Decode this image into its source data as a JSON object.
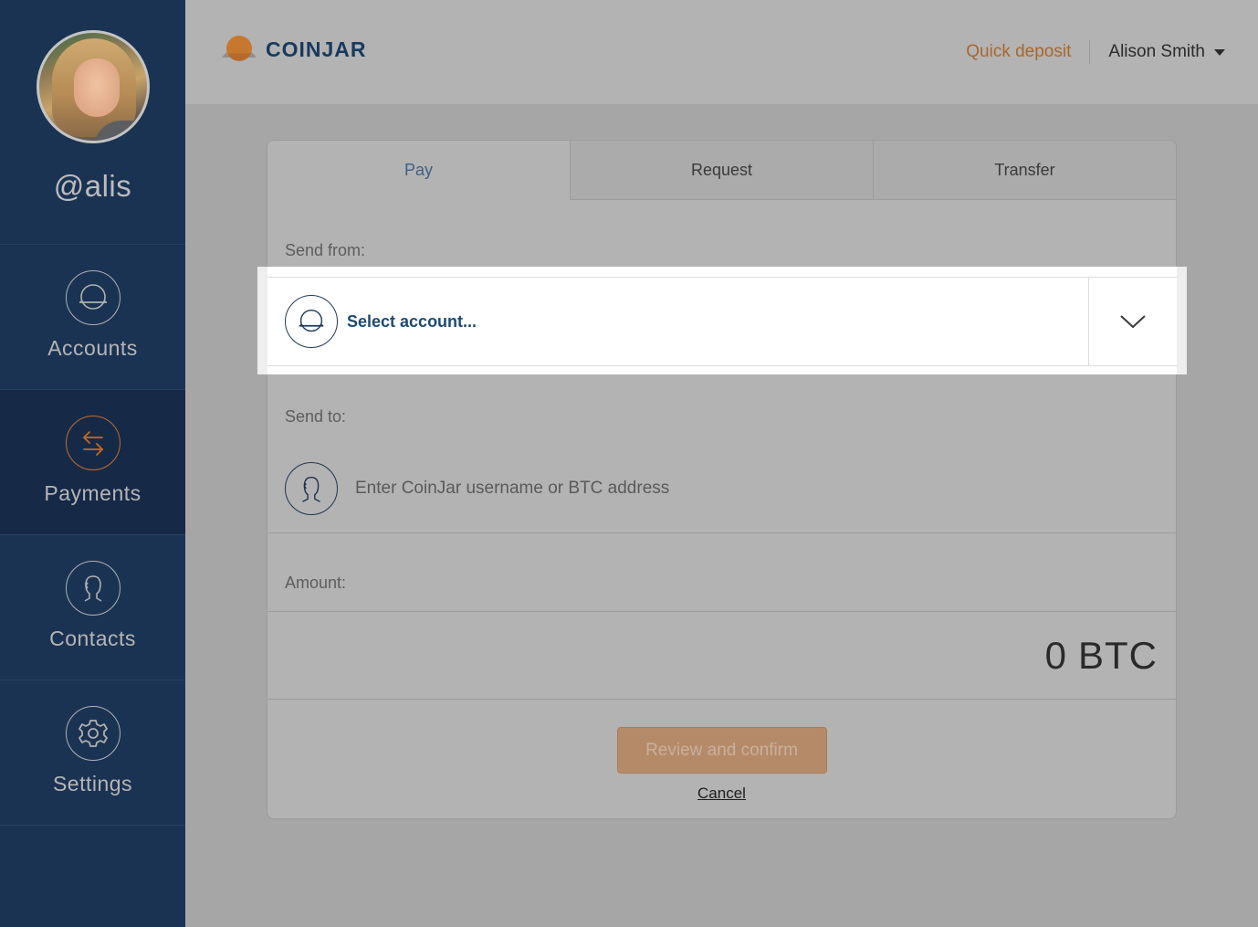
{
  "sidebar": {
    "username": "@alis",
    "items": [
      {
        "label": "Accounts",
        "icon": "account-icon",
        "active": false
      },
      {
        "label": "Payments",
        "icon": "payments-exchange-icon",
        "active": true
      },
      {
        "label": "Contacts",
        "icon": "contact-icon",
        "active": false
      },
      {
        "label": "Settings",
        "icon": "gear-icon",
        "active": false
      }
    ]
  },
  "header": {
    "brand": "COINJAR",
    "quick_deposit": "Quick deposit",
    "user_name": "Alison Smith"
  },
  "payment_form": {
    "tabs": [
      {
        "label": "Pay",
        "active": true
      },
      {
        "label": "Request",
        "active": false
      },
      {
        "label": "Transfer",
        "active": false
      }
    ],
    "send_from_label": "Send from:",
    "select_account_placeholder": "Select account...",
    "send_to_label": "Send to:",
    "recipient_placeholder": "Enter CoinJar username or BTC address",
    "amount_label": "Amount:",
    "amount_value": "0",
    "amount_currency": "BTC",
    "review_button": "Review and confirm",
    "cancel_link": "Cancel"
  },
  "colors": {
    "sidebar_bg": "#1b3353",
    "sidebar_active_bg": "#162a48",
    "accent_orange": "#c06c2a",
    "brand_navy": "#173a5e",
    "overlay_grey": "#a6a6a6"
  }
}
